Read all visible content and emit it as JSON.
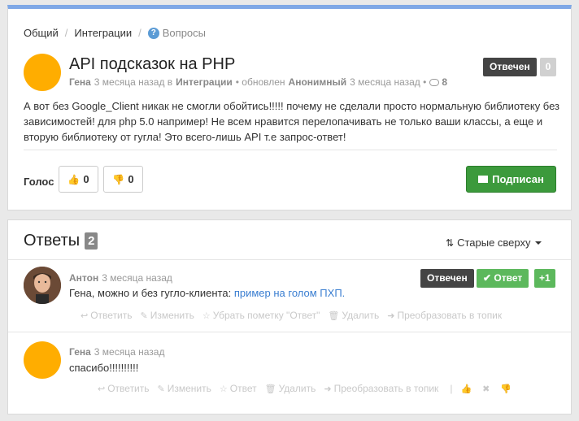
{
  "breadcrumb": {
    "items": [
      "Общий",
      "Интеграции"
    ],
    "current": "Вопросы",
    "separator": "/"
  },
  "topic": {
    "title": "API подсказок на PHP",
    "status_badge": "Отвечен",
    "score_badge": "0",
    "author": "Гена",
    "time": "3 месяца назад в",
    "category": "Интеграции",
    "updated_prefix": "• обновлен",
    "updated_by": "Анонимный",
    "updated_time": "3 месяца назад •",
    "reply_count": "8",
    "body": "А вот без Google_Client никак не смогли обойтись!!!!! почему не сделали просто нормальную библиотеку без зависимостей! для php 5.0 например! Не всем нравится перелопачивать не только ваши классы, а еще и вторую библиотеку от гугла! Это всего-лишь API т.е запрос-ответ!"
  },
  "vote": {
    "label": "Голос",
    "up_count": "0",
    "down_count": "0"
  },
  "subscribe": {
    "label": "Подписан"
  },
  "answers": {
    "title": "Ответы",
    "count": "2",
    "sort_label": "Старые сверху",
    "items": [
      {
        "author": "Антон",
        "time": "3 месяца назад",
        "text_prefix": "Гена, можно и без гугло-клиента:",
        "link_text": "пример на голом ПХП.",
        "badge_answered": "Отвечен",
        "badge_answer": "Ответ",
        "badge_plus": "+1",
        "actions": [
          "Ответить",
          "Изменить",
          "Убрать пометку \"Ответ\"",
          "Удалить",
          "Преобразовать в топик"
        ]
      },
      {
        "author": "Гена",
        "time": "3 месяца назад",
        "text": "спасибо!!!!!!!!!!",
        "actions": [
          "Ответить",
          "Изменить",
          "Ответ",
          "Удалить",
          "Преобразовать в топик"
        ]
      }
    ]
  },
  "colors": {
    "top_border": "#7fa8e6",
    "subscribe_green": "#3c9a3c",
    "badge_green": "#5cb85c",
    "badge_dark": "#444444",
    "avatar_orange": "#ffad00",
    "link_blue": "#3a7ed1"
  }
}
